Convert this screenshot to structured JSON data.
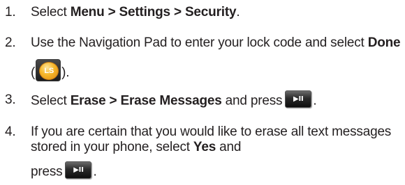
{
  "steps": [
    {
      "number": "1.",
      "lines": [
        {
          "t1": "Select ",
          "b1": "Menu > Settings > Security",
          "t2": "."
        }
      ]
    },
    {
      "number": "2.",
      "line1": {
        "t1": "Use the Navigation Pad to enter your lock code and select ",
        "b1": "Done"
      },
      "line2": {
        "open": "(",
        "key_label": "LS",
        "close": ")."
      }
    },
    {
      "number": "3.",
      "line1": {
        "t1": "Select ",
        "b1": "Erase > Erase Messages",
        "t2": " and press",
        "key_label": "▶II",
        "t3": "."
      }
    },
    {
      "number": "4.",
      "line1": {
        "t1": "If you are certain that you would like to erase all text messages"
      },
      "line2": {
        "t1": "stored in your phone, select ",
        "b1": "Yes",
        "t2": " and"
      },
      "line3": {
        "t1": "press",
        "key_label": "▶II",
        "t3": "."
      }
    }
  ],
  "icons": {
    "left_soft_key": "left-soft-key-icon",
    "ok_key": "ok-play-pause-key-icon"
  }
}
